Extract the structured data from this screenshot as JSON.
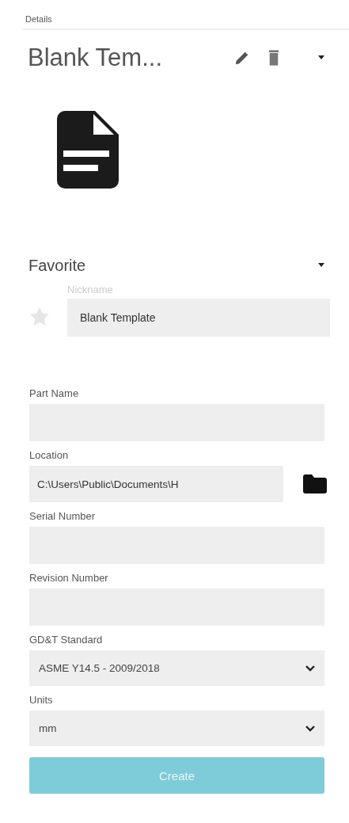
{
  "panel": {
    "title": "Details"
  },
  "template": {
    "name": "Blank Tem...",
    "favorite": false,
    "favorite_label": "Favorite",
    "nickname": {
      "label": "Nickname",
      "value": "Blank Template"
    }
  },
  "fields": [
    {
      "kind": "text",
      "label": "Part Name"
    },
    {
      "kind": "path",
      "label": "Location",
      "value": "C:\\Users\\Public\\Documents\\H"
    },
    {
      "kind": "text",
      "label": "Serial Number"
    },
    {
      "kind": "text",
      "label": "Revision Number"
    },
    {
      "kind": "select",
      "label": "GD&T Standard",
      "value": "ASME Y14.5 - 2009/2018"
    },
    {
      "kind": "select",
      "label": "Units",
      "value": "mm"
    }
  ],
  "buttons": [
    {
      "label": "Create",
      "disabled": true
    }
  ]
}
